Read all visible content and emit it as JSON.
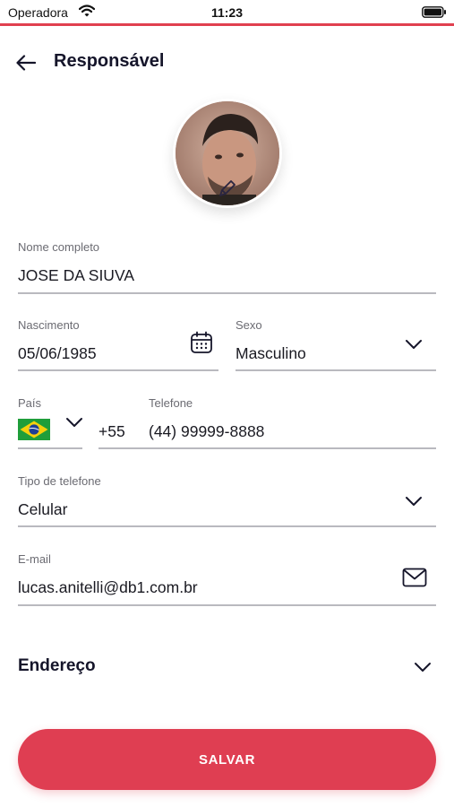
{
  "status_bar": {
    "carrier": "Operadora",
    "time": "11:23"
  },
  "header": {
    "title": "Responsável"
  },
  "form": {
    "full_name": {
      "label": "Nome completo",
      "value": "JOSE DA SIUVA"
    },
    "birth_date": {
      "label": "Nascimento",
      "value": "05/06/1985"
    },
    "sex": {
      "label": "Sexo",
      "value": "Masculino"
    },
    "country": {
      "label": "País",
      "selected_flag": "brazil-flag"
    },
    "phone": {
      "label": "Telefone",
      "dial_code": "+55",
      "value": "(44) 99999-8888"
    },
    "phone_type": {
      "label": "Tipo de telefone",
      "value": "Celular"
    },
    "email": {
      "label": "E-mail",
      "value": "lucas.anitelli@db1.com.br"
    }
  },
  "address_section": {
    "title": "Endereço"
  },
  "actions": {
    "save_label": "SALVAR"
  },
  "colors": {
    "accent": "#df3e52",
    "title_text": "#15152a",
    "label_text": "#6b6b72",
    "underline": "#b9b9bf"
  }
}
